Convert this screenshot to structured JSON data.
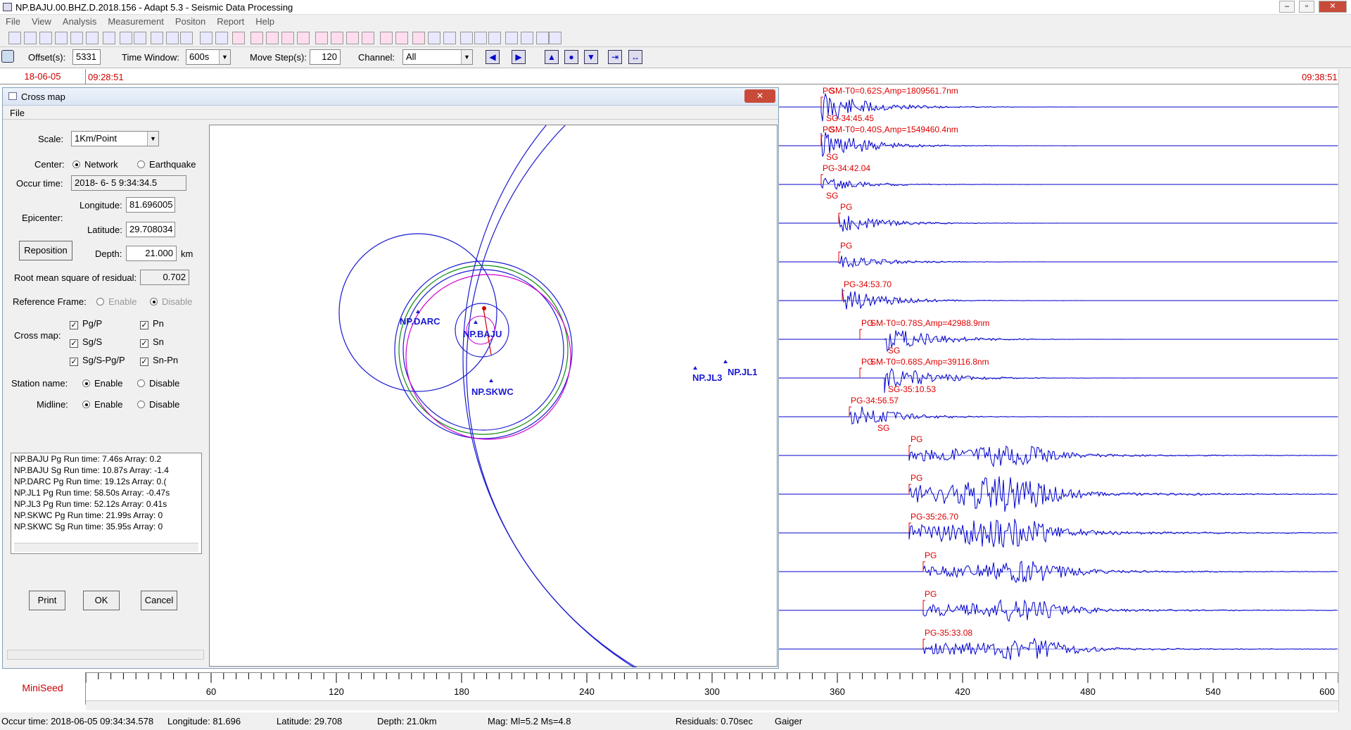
{
  "window": {
    "title": "NP.BAJU.00.BHZ.D.2018.156 - Adapt 5.3 - Seismic Data Processing"
  },
  "menu": [
    "File",
    "View",
    "Analysis",
    "Measurement",
    "Positon",
    "Report",
    "Help"
  ],
  "options": {
    "offset_label": "Offset(s):",
    "offset": "5331",
    "time_window_label": "Time Window:",
    "time_window": "600s",
    "move_step_label": "Move Step(s):",
    "move_step": "120",
    "channel_label": "Channel:",
    "channel": "All"
  },
  "timebar": {
    "date": "18-06-05",
    "start": "09:28:51",
    "end": "09:38:51"
  },
  "crossmap": {
    "title": "Cross map",
    "menu": "File",
    "scale_label": "Scale:",
    "scale": "1Km/Point",
    "center_label": "Center:",
    "center_network": "Network",
    "center_earthquake": "Earthquake",
    "occur_time_label": "Occur time:",
    "occur_time": "2018- 6- 5  9:34:34.5",
    "epicenter_label": "Epicenter:",
    "longitude_label": "Longitude:",
    "longitude": "81.696005",
    "latitude_label": "Latitude:",
    "latitude": "29.708034",
    "reposition": "Reposition",
    "depth_label": "Depth:",
    "depth": "21.000",
    "depth_unit": "km",
    "rms_label": "Root mean square of residual:",
    "rms": "0.702",
    "ref_label": "Reference Frame:",
    "ref_enable": "Enable",
    "ref_disable": "Disable",
    "cross_label": "Cross map:",
    "pgp": "Pg/P",
    "sgs": "Sg/S",
    "sgs_pgp": "Sg/S-Pg/P",
    "pn": "Pn",
    "sn": "Sn",
    "sn_pn": "Sn-Pn",
    "station_label": "Station name:",
    "midline_label": "Midline:",
    "enable": "Enable",
    "disable": "Disable",
    "runs": [
      "NP.BAJU Pg Run time:   7.46s  Array:  0.2",
      "NP.BAJU Sg Run time:  10.87s  Array:  -1.4",
      "NP.DARC Pg Run time:  19.12s  Array:  0.(",
      "NP.JL1 Pg Run time:  58.50s  Array:  -0.47s",
      "NP.JL3 Pg Run time:  52.12s  Array:  0.41s",
      "NP.SKWC Pg Run time:  21.99s  Array:  0",
      "NP.SKWC Sg Run time:  35.95s  Array:  0"
    ],
    "print": "Print",
    "ok": "OK",
    "cancel": "Cancel",
    "stations": {
      "darc": "NP.DARC",
      "baju": "NP.BAJU",
      "skwc": "NP.SKWC",
      "jl3": "NP.JL3",
      "jl1": "NP.JL1"
    }
  },
  "traces": [
    {
      "labels": [
        "PG",
        "SM-T0=0.62S,Amp=1809561.7nm",
        "SG-34:45.45"
      ]
    },
    {
      "labels": [
        "PG",
        "SM-T0=0.40S,Amp=1549460.4nm",
        "SG"
      ]
    },
    {
      "labels": [
        "PG-34:42.04",
        "SG"
      ]
    },
    {
      "labels": [
        "PG"
      ]
    },
    {
      "labels": [
        "PG"
      ]
    },
    {
      "labels": [
        "PG-34:53.70"
      ]
    },
    {
      "labels": [
        "PG",
        "SM-T0=0.78S,Amp=42988.9nm",
        "SG"
      ]
    },
    {
      "labels": [
        "PG",
        "SM-T0=0.68S,Amp=39116.8nm",
        "SG-35:10.53"
      ]
    },
    {
      "labels": [
        "PG-34:56.57",
        "SG"
      ]
    },
    {
      "labels": [
        "PG"
      ]
    },
    {
      "labels": [
        "PG"
      ]
    },
    {
      "labels": [
        "PG-35:26.70"
      ]
    },
    {
      "labels": [
        "PG"
      ]
    },
    {
      "labels": [
        "PG"
      ]
    },
    {
      "labels": [
        "PG-35:33.08"
      ]
    }
  ],
  "axis": {
    "ticks": [
      "60",
      "120",
      "180",
      "240",
      "300",
      "360",
      "420",
      "480",
      "540",
      "600"
    ],
    "format": "MiniSeed"
  },
  "status": {
    "occur": "Occur time:  2018-06-05 09:34:34.578",
    "lon": "Longitude:  81.696",
    "lat": "Latitude:  29.708",
    "depth": "Depth:  21.0km",
    "mag": "Mag:  Ml=5.2 Ms=4.8",
    "resid": "Residuals: 0.70sec",
    "user": "Gaiger"
  }
}
